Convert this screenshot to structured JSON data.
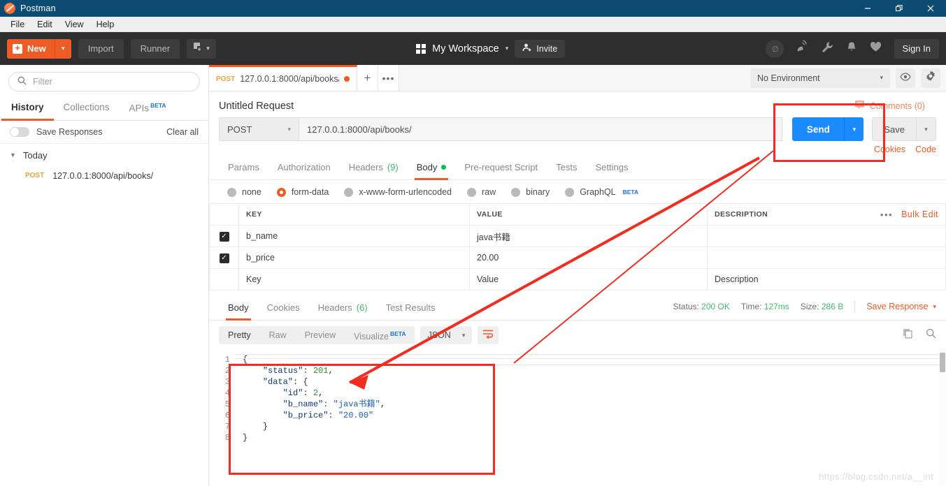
{
  "window": {
    "title": "Postman",
    "logo_icon": "postman-logo-icon",
    "minimize_icon": "minimize-icon",
    "restore_icon": "restore-icon",
    "close_icon": "close-icon"
  },
  "menubar": {
    "items": [
      "File",
      "Edit",
      "View",
      "Help"
    ]
  },
  "toolbar": {
    "new_label": "New",
    "new_caret": "▾",
    "import_label": "Import",
    "runner_label": "Runner",
    "workspace_label": "My Workspace",
    "workspace_caret": "▾",
    "invite_label": "Invite",
    "signin_label": "Sign In",
    "icons": [
      "interceptor-off-icon",
      "satellite-icon",
      "wrench-icon",
      "bell-icon",
      "heart-icon"
    ]
  },
  "sidebar": {
    "filter_placeholder": "Filter",
    "tabs": [
      {
        "label": "History",
        "active": true
      },
      {
        "label": "Collections",
        "active": false
      },
      {
        "label": "APIs",
        "badge": "BETA",
        "active": false
      }
    ],
    "save_responses_label": "Save Responses",
    "clear_all_label": "Clear all",
    "group_label": "Today",
    "history": [
      {
        "method": "POST",
        "url": "127.0.0.1:8000/api/books/"
      }
    ]
  },
  "tabbar": {
    "tab": {
      "method": "POST",
      "url": "127.0.0.1:8000/api/books/"
    },
    "plus_label": "+",
    "more_label": "•••",
    "environment": "No Environment",
    "env_caret": "▾",
    "eye_icon": "eye-icon",
    "gear_icon": "gear-icon"
  },
  "request": {
    "title": "Untitled Request",
    "comments_label": "Comments (0)",
    "method": "POST",
    "method_caret": "▾",
    "url": "127.0.0.1:8000/api/books/",
    "send_label": "Send",
    "send_caret": "▾",
    "save_label": "Save",
    "save_caret": "▾",
    "cookies_label": "Cookies",
    "code_label": "Code",
    "tabs": [
      {
        "label": "Params",
        "active": false
      },
      {
        "label": "Authorization",
        "active": false
      },
      {
        "label": "Headers",
        "count": "(9)",
        "active": false
      },
      {
        "label": "Body",
        "active": true,
        "dot": true
      },
      {
        "label": "Pre-request Script",
        "active": false
      },
      {
        "label": "Tests",
        "active": false
      },
      {
        "label": "Settings",
        "active": false
      }
    ],
    "body_types": [
      {
        "label": "none",
        "selected": false
      },
      {
        "label": "form-data",
        "selected": true
      },
      {
        "label": "x-www-form-urlencoded",
        "selected": false
      },
      {
        "label": "raw",
        "selected": false
      },
      {
        "label": "binary",
        "selected": false
      },
      {
        "label": "GraphQL",
        "selected": false,
        "badge": "BETA"
      }
    ],
    "table": {
      "headers": [
        "KEY",
        "VALUE",
        "DESCRIPTION"
      ],
      "bulk_edit_label": "Bulk Edit",
      "more_label": "•••",
      "rows": [
        {
          "checked": true,
          "key": "b_name",
          "value": "java书籍",
          "description": ""
        },
        {
          "checked": true,
          "key": "b_price",
          "value": "20.00",
          "description": ""
        }
      ],
      "placeholder_row": {
        "key": "Key",
        "value": "Value",
        "description": "Description"
      }
    }
  },
  "response": {
    "tabs": [
      {
        "label": "Body",
        "active": true
      },
      {
        "label": "Cookies",
        "active": false
      },
      {
        "label": "Headers",
        "count": "(6)",
        "active": false
      },
      {
        "label": "Test Results",
        "active": false
      }
    ],
    "status_label": "Status:",
    "status_value": "200 OK",
    "time_label": "Time:",
    "time_value": "127ms",
    "size_label": "Size:",
    "size_value": "286 B",
    "save_response_label": "Save Response",
    "save_response_caret": "▾",
    "view_tabs": [
      {
        "label": "Pretty",
        "active": true
      },
      {
        "label": "Raw",
        "active": false
      },
      {
        "label": "Preview",
        "active": false
      },
      {
        "label": "Visualize",
        "badge": "BETA",
        "active": false
      }
    ],
    "format": "JSON",
    "format_caret": "▾",
    "wrap_icon": "word-wrap-icon",
    "copy_icon": "copy-icon",
    "search_icon": "search-icon",
    "line_numbers": [
      "1",
      "2",
      "3",
      "4",
      "5",
      "6",
      "7",
      "8"
    ],
    "body_text": "{\n    \"status\": 201,\n    \"data\": {\n        \"id\": 2,\n        \"b_name\": \"java书籍\",\n        \"b_price\": \"20.00\"\n    }\n}"
  },
  "watermark": "https://blog.csdn.net/a__int",
  "colors": {
    "titlebar": "#0c4c73",
    "accent_orange": "#ef5b25",
    "send_blue": "#1a8cff",
    "status_green": "#3dbb70",
    "annotation_red": "#f22c1f"
  }
}
